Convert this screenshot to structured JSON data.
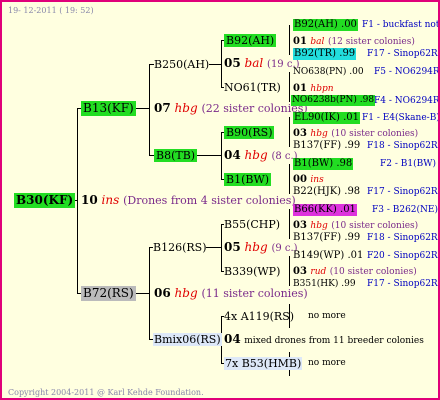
{
  "header": {
    "date": "19- 12-2011 ( 19: 52)"
  },
  "footer": {
    "copyright": "Copyright 2004-2011 @ Karl Kehde Foundation."
  },
  "root": {
    "id": "B30(KF)",
    "gen_number": "10",
    "gen_code": "ins",
    "note": "(Drones from 4 sister colonies)"
  },
  "father": {
    "id": "B13(KF)",
    "gen_number": "07",
    "gen_code": "hbg",
    "note": "(22 sister colonies)",
    "ff": {
      "id": "B250(AH)",
      "gen_number": "05",
      "gen_code": "bal",
      "note": "(19 c.)",
      "fff": {
        "id": "B92(AH)",
        "gen_number": "01",
        "gen_code": "bal",
        "note": "(12 sister colonies)",
        "top_id": "B92(AH)",
        "top_val": ".00",
        "top_src": "F1 - buckfast not",
        "bot_id": "B92(TR)",
        "bot_val": ".99",
        "bot_src": "F17 - Sinop62R"
      },
      "ffm": {
        "id": "NO61(TR)",
        "gen_number": "01",
        "gen_code": "hbpn",
        "top_id": "NO638(PN)",
        "top_val": ".00",
        "top_src": "F5 - NO6294R",
        "bot_id": "NO6238b(PN)",
        "bot_val": ".98",
        "bot_src": "F4 - NO6294R"
      }
    },
    "fm": {
      "id": "B8(TB)",
      "gen_number": "04",
      "gen_code": "hbg",
      "note": "(8 c.)",
      "fmf": {
        "id": "B90(RS)",
        "gen_number": "03",
        "gen_code": "hbg",
        "note": "(10 sister colonies)",
        "top_id": "EL90(IK)",
        "top_val": ".01",
        "top_src": "F1 - E4(Skane-B)",
        "bot_id": "B137(FF)",
        "bot_val": ".99",
        "bot_src": "F18 - Sinop62R"
      },
      "fmm": {
        "id": "B1(BW)",
        "gen_number": "00",
        "gen_code": "ins",
        "top_id": "B1(BW)",
        "top_val": ".98",
        "top_src": "F2 - B1(BW)",
        "bot_id": "B22(HJK)",
        "bot_val": ".98",
        "bot_src": "F17 - Sinop62R"
      }
    }
  },
  "mother": {
    "id": "B72(RS)",
    "gen_number": "06",
    "gen_code": "hbg",
    "note": "(11 sister colonies)",
    "mf": {
      "id": "B126(RS)",
      "gen_number": "05",
      "gen_code": "hbg",
      "note": "(9 c.)",
      "mff": {
        "id": "B55(CHP)",
        "gen_number": "03",
        "gen_code": "hbg",
        "note": "(10 sister colonies)",
        "top_id": "B66(KK)",
        "top_val": ".01",
        "top_src": "F3 - B262(NE)",
        "bot_id": "B137(FF)",
        "bot_val": ".99",
        "bot_src": "F18 - Sinop62R"
      },
      "mfm": {
        "id": "B339(WP)",
        "gen_number": "03",
        "gen_code": "rud",
        "note": "(10 sister colonies)",
        "top_id": "B149(WP)",
        "top_val": ".01",
        "top_src": "F20 - Sinop62R",
        "bot_id": "B351(HK)",
        "bot_val": ".99",
        "bot_src": "F17 - Sinop62R"
      }
    },
    "mm": {
      "id": "Bmix06(RS)",
      "gen_number": "04",
      "gen_note": "mixed drones from 11 breeder colonies",
      "a": {
        "id": "4x A119(RS)",
        "more": "no more"
      },
      "b": {
        "id": "7x B53(HMB)",
        "more": "no more"
      }
    }
  }
}
